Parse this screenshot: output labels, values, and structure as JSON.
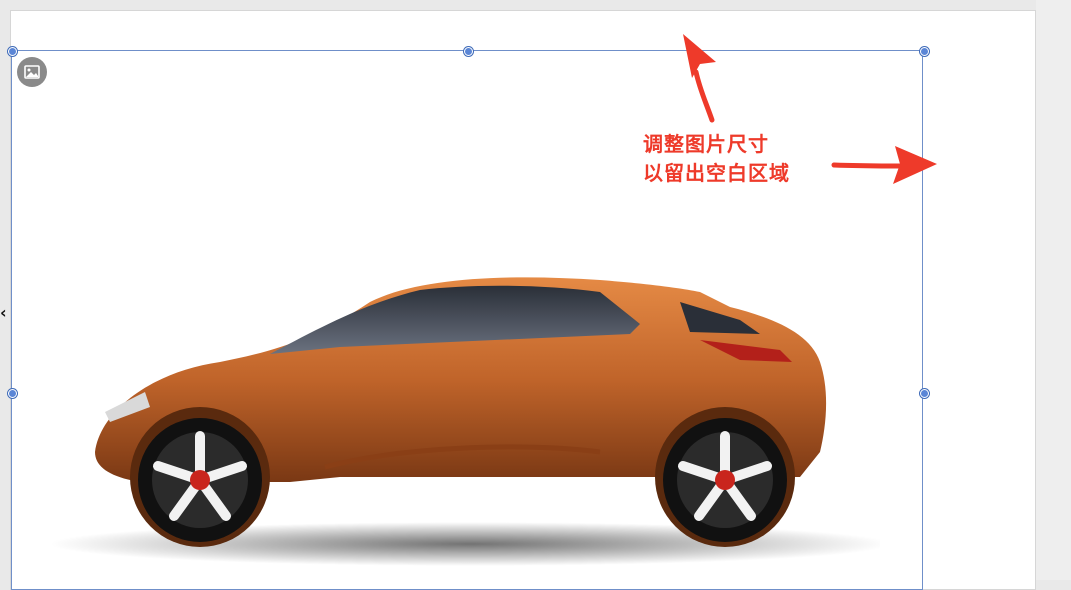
{
  "canvas": {
    "background": "#e9e9e9",
    "slide_background": "#ffffff",
    "selection_color": "#5b86d6"
  },
  "annotation": {
    "line1": "调整图片尺寸",
    "line2": "以留出空白区域",
    "color": "#ee3a2a"
  },
  "image": {
    "subject_icon": "car-photo",
    "car_color": "#c0642a",
    "placeholder_icon": "image-icon"
  },
  "arrows": {
    "up_arrow": "arrow-up-icon",
    "right_arrow": "arrow-right-icon",
    "left_edge": "‹"
  }
}
